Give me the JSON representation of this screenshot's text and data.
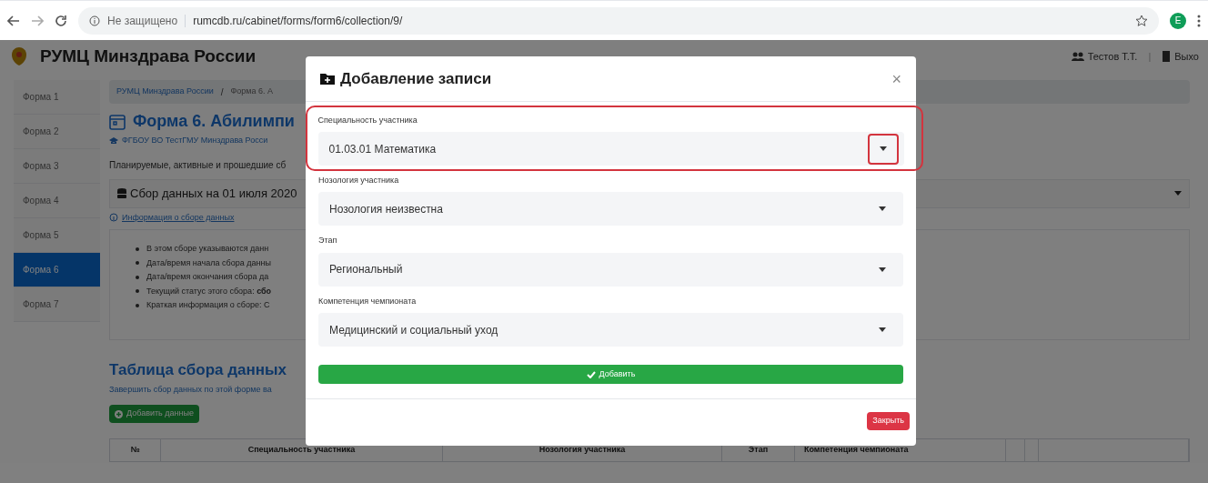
{
  "browser": {
    "security": "Не защищено",
    "url": "rumcdb.ru/cabinet/forms/form6/collection/9/",
    "avatar": "E"
  },
  "header": {
    "title": "РУМЦ Минздрава России",
    "user": "Тестов Т.Т.",
    "separator": "|",
    "logout": "Выхо"
  },
  "sidebar": {
    "items": [
      {
        "label": "Форма 1",
        "selected": false
      },
      {
        "label": "Форма 2",
        "selected": false
      },
      {
        "label": "Форма 3",
        "selected": false
      },
      {
        "label": "Форма 4",
        "selected": false
      },
      {
        "label": "Форма 5",
        "selected": false
      },
      {
        "label": "Форма 6",
        "selected": true
      },
      {
        "label": "Форма 7",
        "selected": false
      }
    ]
  },
  "page": {
    "breadcrumb": {
      "items": [
        "РУМЦ Минздрава России",
        "Форма 6. А"
      ],
      "separator": "/"
    },
    "title": "Форма 6. Абилимпи",
    "organization": "ФГБОУ ВО ТестГМУ Минздрава Росси",
    "intro": "Планируемые, активные и прошедшие сб",
    "collection": "Сбор данных на 01 июля 2020",
    "info_link": "Информация о сборе данных",
    "info_items": [
      "В этом сборе указываются данн",
      "Дата/время начала сбора данны",
      "Дата/время окончания сбора да",
      "Текущий статус этого сбора: **сбо**",
      "Краткая информация о сборе: С"
    ],
    "table_title": "Таблица сбора данных",
    "finish_link": "Завершить сбор данных по этой форме ва",
    "add_button": "Добавить данные",
    "table": {
      "columns": [
        "№",
        "Специальность участника",
        "Нозология участника",
        "Этап",
        "Компетенция чемпионата"
      ]
    }
  },
  "modal": {
    "title": "Добавление записи",
    "close": "×",
    "fields": [
      {
        "label": "Специальность участника",
        "value": "01.03.01 Математика",
        "highlighted": true
      },
      {
        "label": "Нозология участника",
        "value": "Нозология неизвестна",
        "highlighted": false
      },
      {
        "label": "Этап",
        "value": "Региональный",
        "highlighted": false
      },
      {
        "label": "Компетенция чемпионата",
        "value": "Медицинский и социальный уход",
        "highlighted": false
      }
    ],
    "submit": "Добавить",
    "cancel": "Закрыть"
  }
}
